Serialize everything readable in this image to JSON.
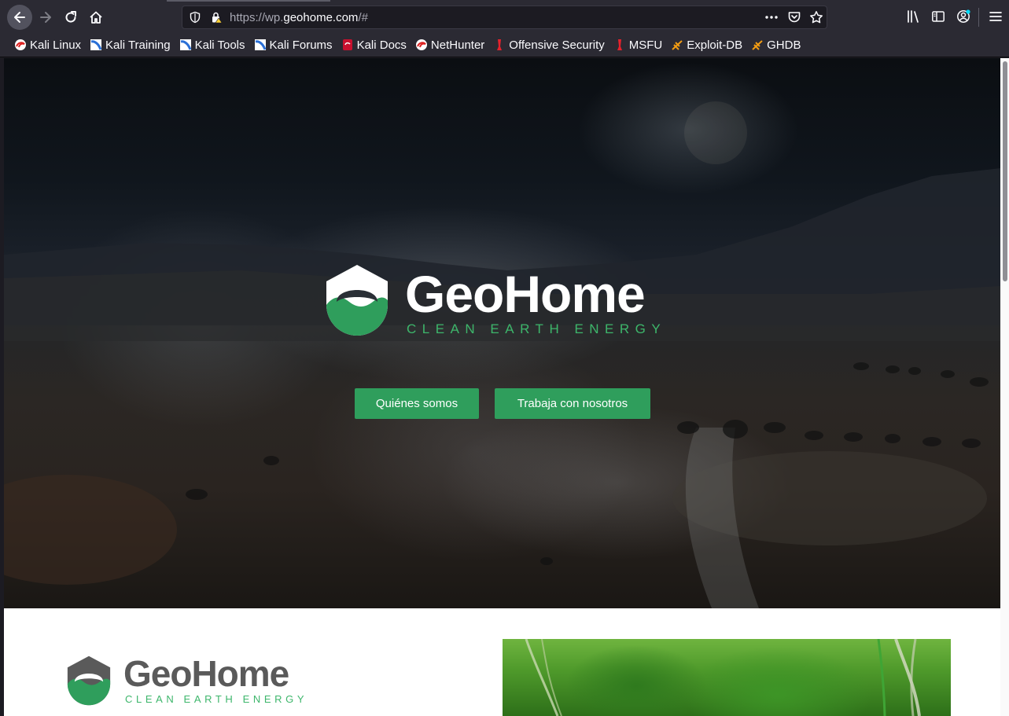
{
  "browser": {
    "url_scheme": "https://wp.",
    "url_host": "geohome.com",
    "url_path": "/#",
    "bookmarks": [
      {
        "label": "Kali Linux",
        "icon": "kali-dragon-icon"
      },
      {
        "label": "Kali Training",
        "icon": "kali-training-icon"
      },
      {
        "label": "Kali Tools",
        "icon": "kali-tools-icon"
      },
      {
        "label": "Kali Forums",
        "icon": "kali-forums-icon"
      },
      {
        "label": "Kali Docs",
        "icon": "kali-docs-icon"
      },
      {
        "label": "NetHunter",
        "icon": "kali-dragon-icon"
      },
      {
        "label": "Offensive Security",
        "icon": "offsec-icon"
      },
      {
        "label": "MSFU",
        "icon": "offsec-icon"
      },
      {
        "label": "Exploit-DB",
        "icon": "exploit-db-icon"
      },
      {
        "label": "GHDB",
        "icon": "exploit-db-icon"
      }
    ]
  },
  "hero": {
    "brand_name": "GeoHome",
    "tagline": "CLEAN EARTH ENERGY",
    "buttons": {
      "about": "Quiénes somos",
      "work": "Trabaja con nosotros"
    }
  },
  "section": {
    "brand_name": "GeoHome",
    "tagline": "CLEAN EARTH ENERGY"
  },
  "colors": {
    "brand_green": "#2f9e5c",
    "tagline_green": "#3db66b",
    "chrome_bg": "#2b2a33"
  }
}
